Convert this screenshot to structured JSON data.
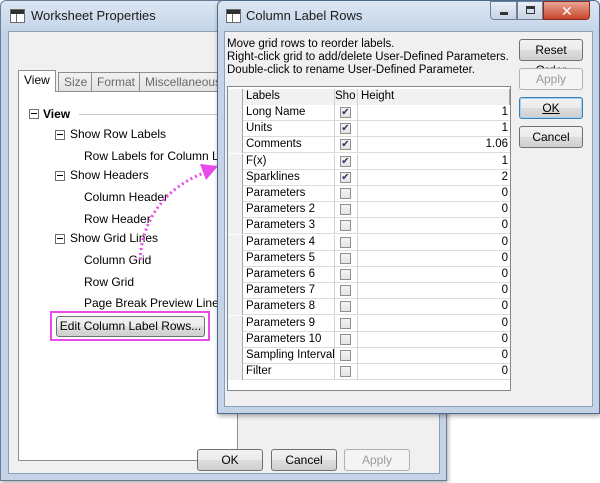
{
  "worksheet_dialog": {
    "title": "Worksheet Properties",
    "tabs": [
      "View",
      "Size",
      "Format",
      "Miscellaneous"
    ],
    "tree": {
      "root": "View",
      "show_row_labels": "Show Row Labels",
      "row_labels_for_column_label": "Row Labels for Column Labe",
      "show_headers": "Show Headers",
      "column_header": "Column Header",
      "row_header": "Row Header",
      "show_grid_lines": "Show Grid Lines",
      "column_grid": "Column Grid",
      "row_grid": "Row Grid",
      "page_break_preview_lines": "Page Break Preview Lines"
    },
    "edit_button_label": "Edit Column Label Rows...",
    "ok_label": "OK",
    "cancel_label": "Cancel",
    "apply_label": "Apply",
    "highlight_color": "#e84be8"
  },
  "label_rows_dialog": {
    "title": "Column Label Rows",
    "instructions": [
      "Move grid rows to reorder labels.",
      "Right-click grid to add/delete User-Defined Parameters.",
      "Double-click to rename User-Defined Parameter."
    ],
    "reset_order_label": "Reset Order",
    "apply_label": "Apply",
    "ok_label": "OK",
    "cancel_label": "Cancel",
    "grid": {
      "columns": [
        "Labels",
        "Sho",
        "Height"
      ],
      "rows": [
        {
          "label": "Long Name",
          "show": true,
          "height": "1"
        },
        {
          "label": "Units",
          "show": true,
          "height": "1"
        },
        {
          "label": "Comments",
          "show": true,
          "height": "1.06"
        },
        {
          "label": "F(x)",
          "show": true,
          "height": "1"
        },
        {
          "label": "Sparklines",
          "show": true,
          "height": "2"
        },
        {
          "label": "Parameters",
          "show": false,
          "height": "0"
        },
        {
          "label": "Parameters 2",
          "show": false,
          "height": "0"
        },
        {
          "label": "Parameters 3",
          "show": false,
          "height": "0"
        },
        {
          "label": "Parameters 4",
          "show": false,
          "height": "0"
        },
        {
          "label": "Parameters 5",
          "show": false,
          "height": "0"
        },
        {
          "label": "Parameters 6",
          "show": false,
          "height": "0"
        },
        {
          "label": "Parameters 7",
          "show": false,
          "height": "0"
        },
        {
          "label": "Parameters 8",
          "show": false,
          "height": "0"
        },
        {
          "label": "Parameters 9",
          "show": false,
          "height": "0"
        },
        {
          "label": "Parameters 10",
          "show": false,
          "height": "0"
        },
        {
          "label": "Sampling Interval",
          "show": false,
          "height": "0"
        },
        {
          "label": "Filter",
          "show": false,
          "height": "0"
        }
      ]
    }
  }
}
